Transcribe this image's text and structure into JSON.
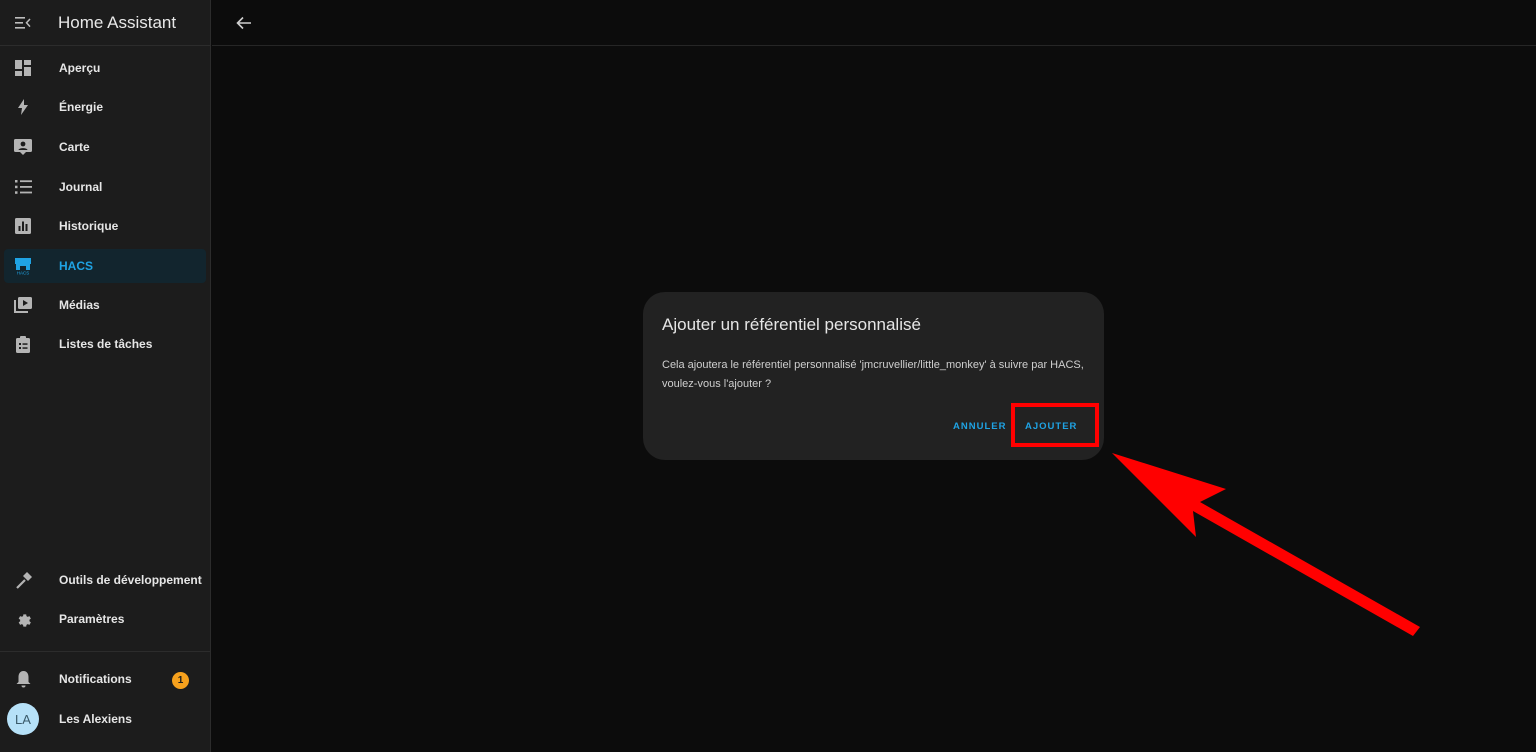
{
  "app": {
    "title": "Home Assistant"
  },
  "sidebar": {
    "items": [
      {
        "label": "Aperçu",
        "icon": "dashboard-icon"
      },
      {
        "label": "Énergie",
        "icon": "lightning-icon"
      },
      {
        "label": "Carte",
        "icon": "map-account-icon"
      },
      {
        "label": "Journal",
        "icon": "list-icon"
      },
      {
        "label": "Historique",
        "icon": "chart-box-icon"
      },
      {
        "label": "HACS",
        "icon": "hacs-store-icon",
        "active": true
      },
      {
        "label": "Médias",
        "icon": "play-box-icon"
      },
      {
        "label": "Listes de tâches",
        "icon": "clipboard-list-icon"
      }
    ],
    "bottom": {
      "devtools": "Outils de développement",
      "settings": "Paramètres",
      "notifications": "Notifications",
      "notifications_count": "1",
      "user_initials": "LA",
      "user_name": "Les Alexiens"
    }
  },
  "dialog": {
    "title": "Ajouter un référentiel personnalisé",
    "body": "Cela ajoutera le référentiel personnalisé 'jmcruvellier/little_monkey' à suivre par HACS, voulez-vous l'ajouter ?",
    "cancel_label": "ANNULER",
    "confirm_label": "AJOUTER"
  },
  "colors": {
    "accent": "#1fa3e4",
    "annotation": "#ff0000",
    "badge": "#f6a11d"
  }
}
